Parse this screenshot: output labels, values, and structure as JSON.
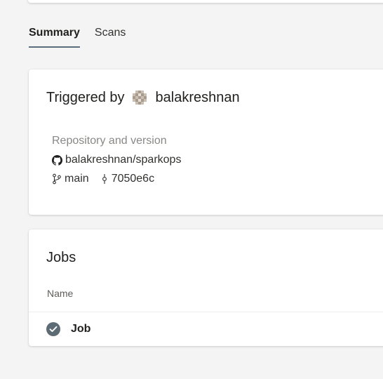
{
  "tabs": [
    {
      "label": "Summary",
      "selected": true
    },
    {
      "label": "Scans",
      "selected": false
    }
  ],
  "trigger": {
    "prefix": "Triggered by",
    "user": "balakreshnan",
    "avatar_icon": "user-avatar-icon"
  },
  "repository": {
    "heading": "Repository and version",
    "name": "balakreshnan/sparkops",
    "repo_icon": "github-icon",
    "branch": "main",
    "branch_icon": "branch-icon",
    "commit": "7050e6c",
    "commit_icon": "commit-icon"
  },
  "jobs": {
    "title": "Jobs",
    "column_header": "Name",
    "items": [
      {
        "name": "Job",
        "status": "succeeded",
        "status_icon": "success-check-icon"
      }
    ]
  },
  "colors": {
    "accent": "#5c6e7d",
    "success": "#5d6c74",
    "background": "#f4f4f4"
  }
}
